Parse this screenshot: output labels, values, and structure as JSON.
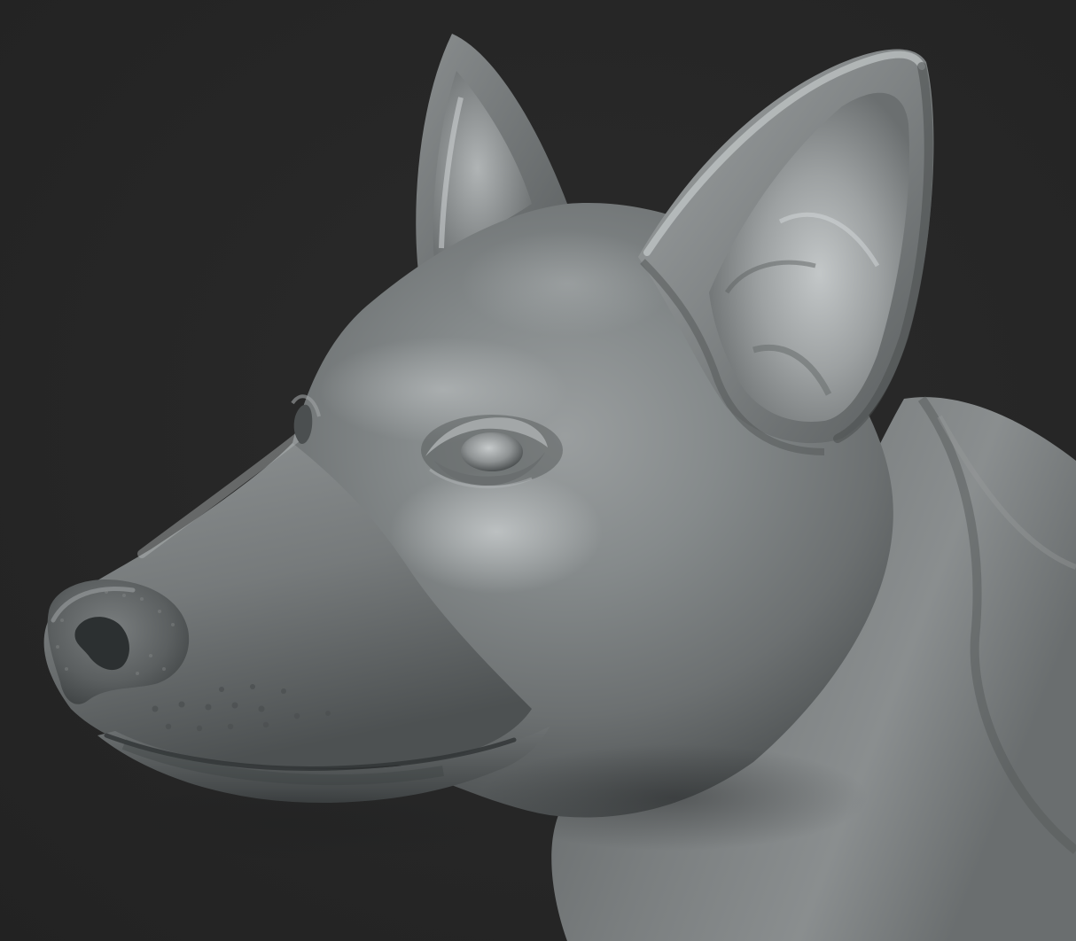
{
  "scene": {
    "subject": "dog-head-sculpt",
    "material": "clay",
    "colors": {
      "background": "#262626",
      "clay_base": "#6f7374",
      "clay_light": "#c7cbcc",
      "clay_mid": "#8c9091",
      "clay_dark": "#3b3e3f",
      "nose": "#55595a"
    }
  }
}
